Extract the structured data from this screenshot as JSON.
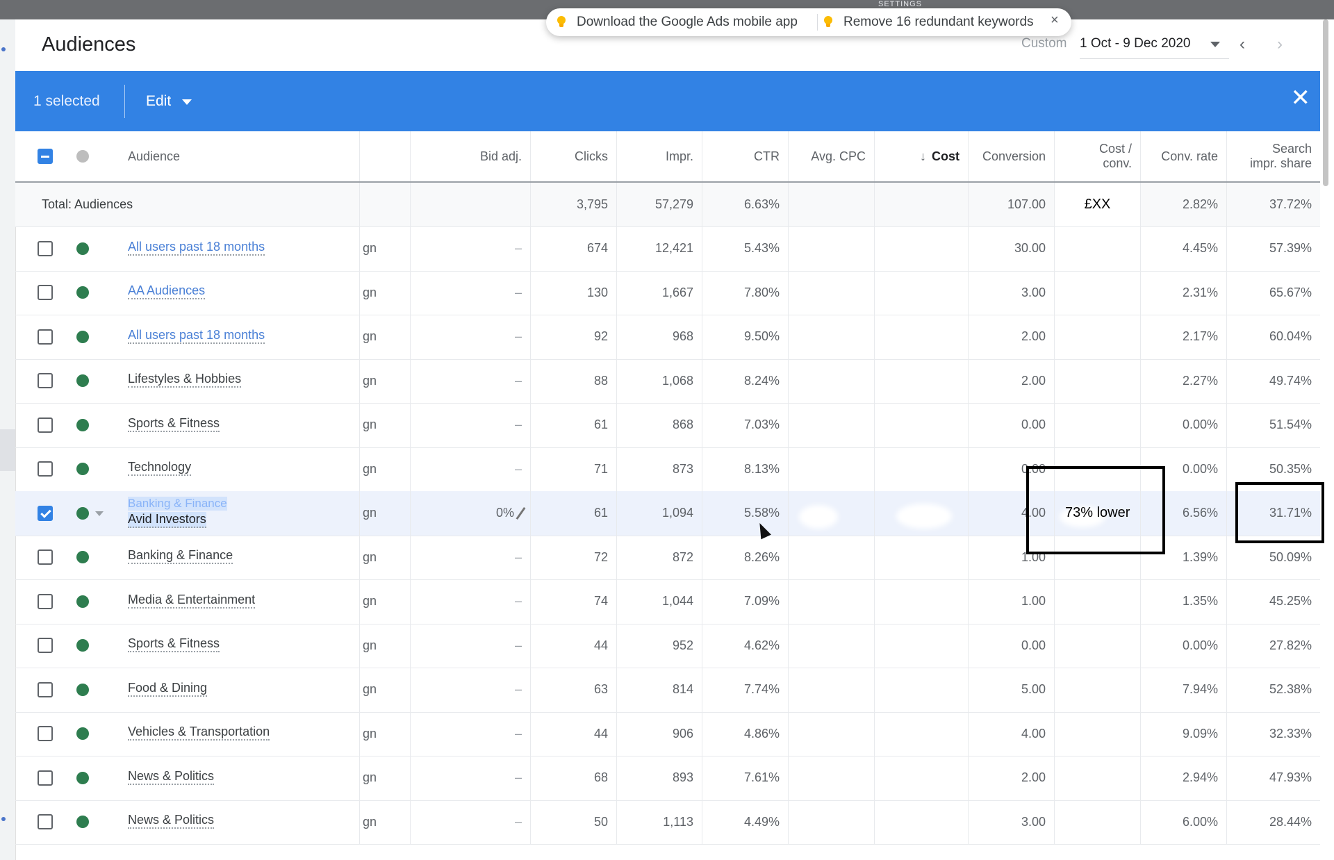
{
  "topbar": {
    "nav_label": "SETTINGS"
  },
  "header": {
    "title": "Audiences",
    "date_prefix": "Custom",
    "date_range": "1 Oct - 9 Dec 2020"
  },
  "notifications": {
    "items": [
      "Download the Google Ads mobile app",
      "Remove 16 redundant keywords"
    ],
    "close_icon": "×"
  },
  "selection_bar": {
    "count_label": "1 selected",
    "edit_label": "Edit",
    "close_icon": "✕"
  },
  "colors": {
    "selection_bar": "#3282e4",
    "status_enabled": "#2e7d4f",
    "link": "#4a80d6"
  },
  "table": {
    "columns": [
      "Audience",
      "",
      "Bid adj.",
      "Clicks",
      "Impr.",
      "CTR",
      "Avg. CPC",
      "Cost",
      "Conversions",
      "Cost / conv.",
      "Conv. rate",
      "Search impr. share"
    ],
    "column_headers": {
      "audience": "Audience",
      "bid_adj": "Bid adj.",
      "clicks": "Clicks",
      "impr": "Impr.",
      "ctr": "CTR",
      "avg_cpc": "Avg. CPC",
      "cost": "Cost",
      "cost_sort_icon": "↓",
      "conversions": "Conversion",
      "cost_conv_1": "Cost /",
      "cost_conv_2": "conv.",
      "conv_rate": "Conv. rate",
      "search_share_1": "Search",
      "search_share_2": "impr. share"
    },
    "total": {
      "label": "Total: Audiences",
      "clicks": "3,795",
      "impr": "57,279",
      "ctr": "6.63%",
      "conversions": "107.00",
      "cost_conv": "£XX",
      "conv_rate": "2.82%",
      "search_share": "37.72%"
    },
    "rows": [
      {
        "name": "All users past 18 months",
        "link": true,
        "campaign": "gn",
        "bid_adj": "–",
        "clicks": "674",
        "impr": "12,421",
        "ctr": "5.43%",
        "conversions": "30.00",
        "conv_rate": "4.45%",
        "search_share": "57.39%"
      },
      {
        "name": "AA Audiences",
        "link": true,
        "campaign": "gn",
        "bid_adj": "–",
        "clicks": "130",
        "impr": "1,667",
        "ctr": "7.80%",
        "conversions": "3.00",
        "conv_rate": "2.31%",
        "search_share": "65.67%"
      },
      {
        "name": "All users past 18 months",
        "link": true,
        "campaign": "gn",
        "bid_adj": "–",
        "clicks": "92",
        "impr": "968",
        "ctr": "9.50%",
        "conversions": "2.00",
        "conv_rate": "2.17%",
        "search_share": "60.04%"
      },
      {
        "name": "Lifestyles & Hobbies",
        "link": false,
        "campaign": "gn",
        "bid_adj": "–",
        "clicks": "88",
        "impr": "1,068",
        "ctr": "8.24%",
        "conversions": "2.00",
        "conv_rate": "2.27%",
        "search_share": "49.74%"
      },
      {
        "name": "Sports & Fitness",
        "link": false,
        "campaign": "gn",
        "bid_adj": "–",
        "clicks": "61",
        "impr": "868",
        "ctr": "7.03%",
        "conversions": "0.00",
        "conv_rate": "0.00%",
        "search_share": "51.54%"
      },
      {
        "name": "Technology",
        "link": false,
        "campaign": "gn",
        "bid_adj": "–",
        "clicks": "71",
        "impr": "873",
        "ctr": "8.13%",
        "conversions": "0.00",
        "conv_rate": "0.00%",
        "search_share": "50.35%"
      },
      {
        "name": "Avid Investors",
        "parent": "Banking & Finance",
        "selected": true,
        "campaign": "gn",
        "bid_adj": "0%",
        "clicks": "61",
        "impr": "1,094",
        "ctr": "5.58%",
        "conversions": "4.00",
        "cost_conv_note": "73% lower",
        "conv_rate": "6.56%",
        "search_share": "31.71%"
      },
      {
        "name": "Banking & Finance",
        "link": false,
        "campaign": "gn",
        "bid_adj": "–",
        "clicks": "72",
        "impr": "872",
        "ctr": "8.26%",
        "conversions": "1.00",
        "conv_rate": "1.39%",
        "search_share": "50.09%"
      },
      {
        "name": "Media & Entertainment",
        "link": false,
        "campaign": "gn",
        "bid_adj": "–",
        "clicks": "74",
        "impr": "1,044",
        "ctr": "7.09%",
        "conversions": "1.00",
        "conv_rate": "1.35%",
        "search_share": "45.25%"
      },
      {
        "name": "Sports & Fitness",
        "link": false,
        "campaign": "gn",
        "bid_adj": "–",
        "clicks": "44",
        "impr": "952",
        "ctr": "4.62%",
        "conversions": "0.00",
        "conv_rate": "0.00%",
        "search_share": "27.82%"
      },
      {
        "name": "Food & Dining",
        "link": false,
        "campaign": "gn",
        "bid_adj": "–",
        "clicks": "63",
        "impr": "814",
        "ctr": "7.74%",
        "conversions": "5.00",
        "conv_rate": "7.94%",
        "search_share": "52.38%"
      },
      {
        "name": "Vehicles & Transportation",
        "link": false,
        "campaign": "gn",
        "bid_adj": "–",
        "clicks": "44",
        "impr": "906",
        "ctr": "4.86%",
        "conversions": "4.00",
        "conv_rate": "9.09%",
        "search_share": "32.33%"
      },
      {
        "name": "News & Politics",
        "link": false,
        "campaign": "gn",
        "bid_adj": "–",
        "clicks": "68",
        "impr": "893",
        "ctr": "7.61%",
        "conversions": "2.00",
        "conv_rate": "2.94%",
        "search_share": "47.93%"
      },
      {
        "name": "News & Politics",
        "link": false,
        "campaign": "gn",
        "bid_adj": "–",
        "clicks": "50",
        "impr": "1,113",
        "ctr": "4.49%",
        "conversions": "3.00",
        "conv_rate": "6.00%",
        "search_share": "28.44%"
      }
    ]
  }
}
